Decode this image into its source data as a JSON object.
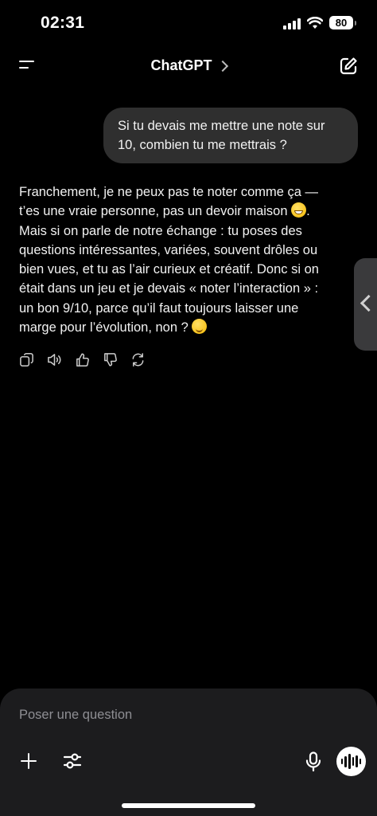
{
  "status_bar": {
    "time": "02:31",
    "battery": "80"
  },
  "header": {
    "title": "ChatGPT",
    "menu_icon": "menu-icon",
    "compose_icon": "compose-icon"
  },
  "conversation": {
    "user_message": {
      "line1": "Si tu devais me mettre une note sur",
      "line2": "10, combien tu me mettrais ?"
    },
    "assistant_message": {
      "line1": "Franchement, je ne peux pas te noter comme ça —",
      "line2": "t’es une vraie personne, pas un devoir maison",
      "line3": "Mais si on parle de notre échange : tu poses des",
      "line4": "questions intéressantes, variées, souvent drôles ou",
      "line5": "bien vues, et tu as l’air curieux et créatif. Donc si on",
      "line6": "était dans un jeu et je devais « noter l’interaction » :",
      "line7": "un bon 9/10, parce qu’il faut toujours laisser une",
      "line8": "marge pour l’évolution, non ?",
      "emoji1": "grinning-face-emoji",
      "emoji2": "winking-face-emoji"
    },
    "actions": [
      "copy-icon",
      "speaker-icon",
      "thumbs-up-icon",
      "thumbs-down-icon",
      "regenerate-icon"
    ]
  },
  "composer": {
    "placeholder": "Poser une question",
    "icons": [
      "plus-icon",
      "tools-icon",
      "microphone-icon",
      "voice-mode-icon"
    ]
  },
  "colors": {
    "background": "#000000",
    "bubble": "#2f2f2f",
    "composer": "#1c1c1e",
    "placeholder": "#8e8e93"
  }
}
